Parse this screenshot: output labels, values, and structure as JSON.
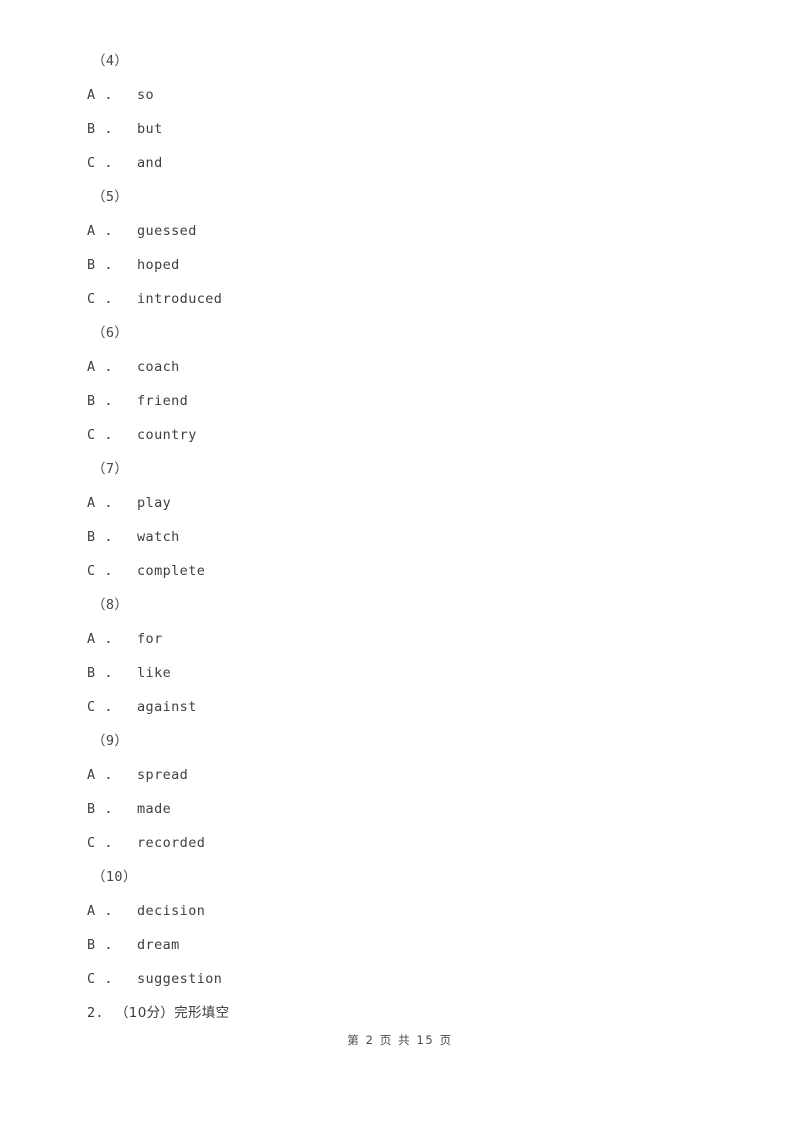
{
  "document": {
    "page_background": "#ffffff",
    "text_color": "#3f3f3f",
    "body": [
      {
        "kind": "stem",
        "text": "（4）"
      },
      {
        "kind": "option",
        "letter": "A",
        "sep": "．",
        "text": "so"
      },
      {
        "kind": "option",
        "letter": "B",
        "sep": "．",
        "text": "but"
      },
      {
        "kind": "option",
        "letter": "C",
        "sep": "．",
        "text": "and"
      },
      {
        "kind": "stem",
        "text": "（5）"
      },
      {
        "kind": "option",
        "letter": "A",
        "sep": "．",
        "text": "guessed"
      },
      {
        "kind": "option",
        "letter": "B",
        "sep": "．",
        "text": "hoped"
      },
      {
        "kind": "option",
        "letter": "C",
        "sep": "．",
        "text": "introduced"
      },
      {
        "kind": "stem",
        "text": "（6）"
      },
      {
        "kind": "option",
        "letter": "A",
        "sep": "．",
        "text": "coach"
      },
      {
        "kind": "option",
        "letter": "B",
        "sep": "．",
        "text": "friend"
      },
      {
        "kind": "option",
        "letter": "C",
        "sep": "．",
        "text": "country"
      },
      {
        "kind": "stem",
        "text": "（7）"
      },
      {
        "kind": "option",
        "letter": "A",
        "sep": "．",
        "text": "play"
      },
      {
        "kind": "option",
        "letter": "B",
        "sep": "．",
        "text": "watch"
      },
      {
        "kind": "option",
        "letter": "C",
        "sep": "．",
        "text": "complete"
      },
      {
        "kind": "stem",
        "text": "（8）"
      },
      {
        "kind": "option",
        "letter": "A",
        "sep": "．",
        "text": "for"
      },
      {
        "kind": "option",
        "letter": "B",
        "sep": "．",
        "text": "like"
      },
      {
        "kind": "option",
        "letter": "C",
        "sep": "．",
        "text": "against"
      },
      {
        "kind": "stem",
        "text": "（9）"
      },
      {
        "kind": "option",
        "letter": "A",
        "sep": "．",
        "text": "spread"
      },
      {
        "kind": "option",
        "letter": "B",
        "sep": "．",
        "text": "made"
      },
      {
        "kind": "option",
        "letter": "C",
        "sep": "．",
        "text": "recorded"
      },
      {
        "kind": "stem",
        "text": "（10）"
      },
      {
        "kind": "option",
        "letter": "A",
        "sep": "．",
        "text": "decision"
      },
      {
        "kind": "option",
        "letter": "B",
        "sep": "．",
        "text": "dream"
      },
      {
        "kind": "option",
        "letter": "C",
        "sep": "．",
        "text": "suggestion"
      },
      {
        "kind": "section",
        "number": "2.",
        "score": "（10分）",
        "title": "完形填空"
      }
    ]
  },
  "footer": {
    "page_label": "第 2 页 共 15 页",
    "current_page": "2",
    "total_pages": "15"
  }
}
